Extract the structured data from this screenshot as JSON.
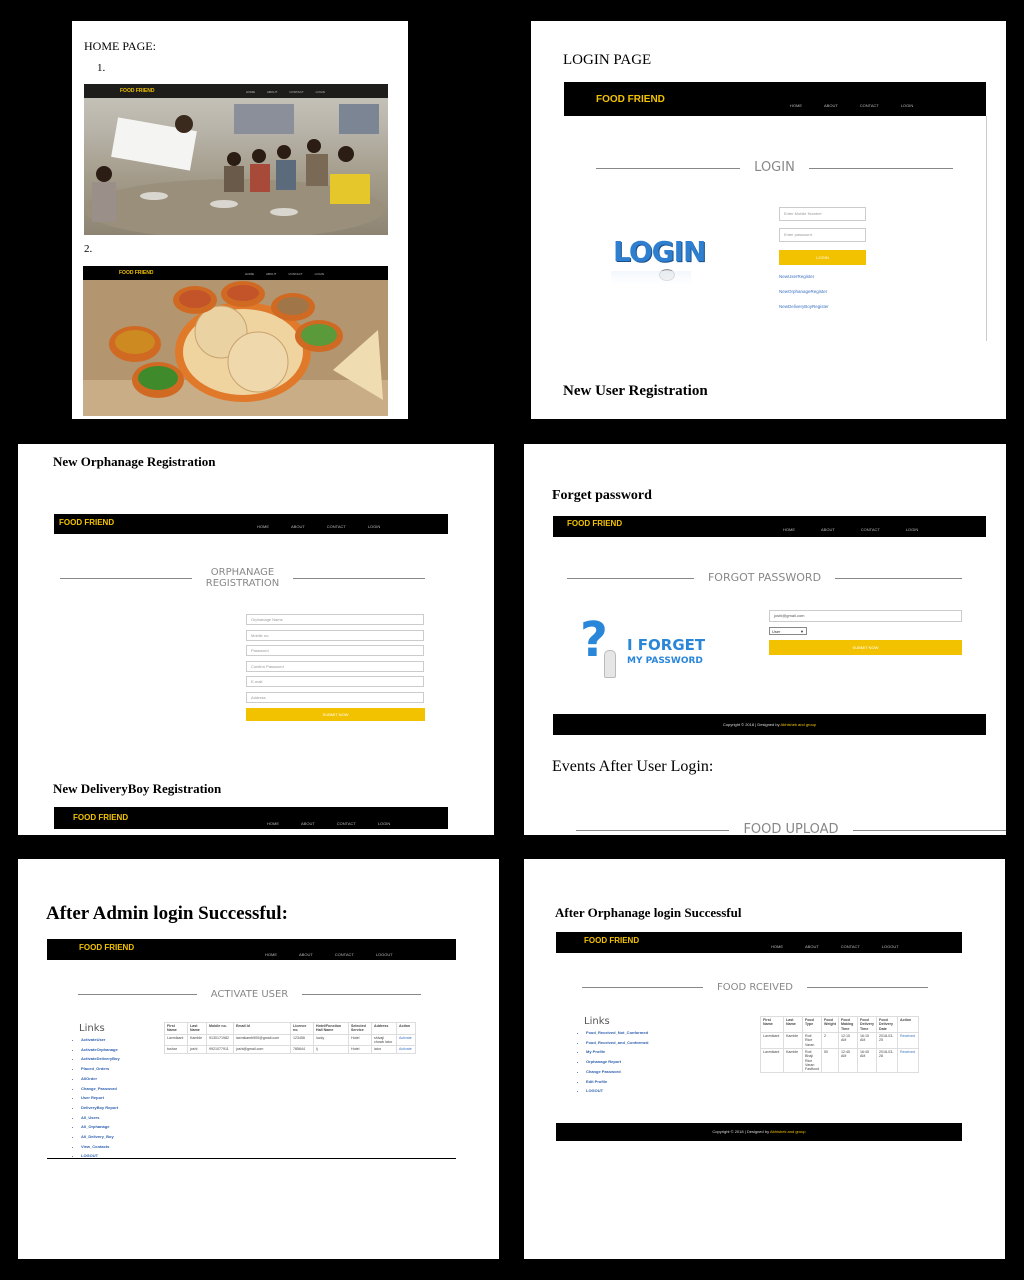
{
  "brand": "FOOD FRIEND",
  "nav": {
    "home": "HOME",
    "about": "ABOUT",
    "contact": "CONTACT",
    "login": "LOGIN",
    "logout": "LOGOUT"
  },
  "footer": {
    "prefix": "Copyright © 2018 | Designed by ",
    "author": "Abhishek and group"
  },
  "home": {
    "heading": "HOME PAGE:",
    "item1": "1.",
    "item2": "2."
  },
  "login": {
    "heading": "LOGIN PAGE",
    "section_title": "LOGIN",
    "logo_text": "LOGIN",
    "mobile_placeholder": "Enter Mobile Number",
    "password_placeholder": "Enter password",
    "button": "LOGIN",
    "link_user": "NewUserRegister",
    "link_orphanage": "NewOrphanageRegister",
    "link_delivery": "NewDeliveryBoyRegister",
    "next_heading": "New User Registration"
  },
  "orphanage": {
    "heading": "New Orphanage Registration",
    "section_line1": "ORPHANAGE",
    "section_line2": "REGISTRATION",
    "f_name": "Orphanage Name",
    "f_mobile": "Mobile no.",
    "f_password": "Password",
    "f_confirm": "Confirm Password",
    "f_email": "E-mail",
    "f_address": "Address",
    "button": "SUBMIT NOW",
    "next_heading": "New DeliveryBoy Registration"
  },
  "forgot": {
    "heading": "Forget password",
    "section_title": "FORGOT PASSWORD",
    "email_value": "joshi@gmail.com",
    "role_selected": "User",
    "button": "SUBMIT NOW",
    "icon_line1": "I FORGET",
    "icon_line2": "MY PASSWORD",
    "events_heading": "Events After User Login:",
    "food_upload": "FOOD UPLOAD"
  },
  "admin": {
    "heading": "After Admin login Successful:",
    "section_title": "ACTIVATE USER",
    "links_title": "Links",
    "links": [
      "ActivateUser",
      "ActivateOrphanage",
      "ActivateDeliveryBoy",
      "Placed_Orders",
      "AllOrder",
      "Change_Password",
      "User Report",
      "DeliveryBoy Report",
      "All_Users",
      "All_Orphanage",
      "All_Delivery_Boy",
      "View_Contacts",
      "LOGOUT"
    ],
    "table": {
      "headers": [
        "First Name",
        "Last Name",
        "Mobile no.",
        "Email Id",
        "Licence no.",
        "Hotel/Function Hall Name",
        "Selected Service",
        "Address",
        "Action"
      ],
      "rows": [
        [
          "Laxmikant",
          "Kamble",
          "9130171982",
          "laxmikamb900@gmail.com",
          "123456",
          "lucky",
          "Hotel",
          "shivaji chowk latur",
          "Activate"
        ],
        [
          "tushar",
          "joshi",
          "9921077911",
          "joshi@gmail.com",
          "785644",
          "lj",
          "Hotel",
          "latur",
          "Activate"
        ]
      ]
    }
  },
  "orph_login": {
    "heading": "After Orphanage login Successful",
    "section_title": "FOOD RCEIVED",
    "links_title": "Links",
    "links": [
      "Food_Received_Not_Conformed",
      "Food_Received_and_Conformed",
      "My Profile",
      "Orphanage Report",
      "Change Password",
      "Edit Profile",
      "LOGOUT"
    ],
    "table": {
      "headers": [
        "First Name",
        "Last Name",
        "Food Type",
        "Food Weight",
        "Food Making Time",
        "Food Delivery Time",
        "Food Delivery Date",
        "Action"
      ],
      "rows": [
        [
          "Laxmikant",
          "Kamble",
          "Roti Rice Varan",
          "2",
          "12:15 AM",
          "16:15 AM",
          "2018-03-25",
          "Received"
        ],
        [
          "Laxmikant",
          "Kamble",
          "Roti Bhaji Rice Varan Fastfood",
          "50",
          "12:45 AM",
          "16:45 AM",
          "2018-03-28",
          "Received"
        ]
      ]
    }
  },
  "colors": {
    "accent": "#f2c200",
    "navbar": "#000000",
    "link": "#3a72c4",
    "section_text": "#888888"
  }
}
